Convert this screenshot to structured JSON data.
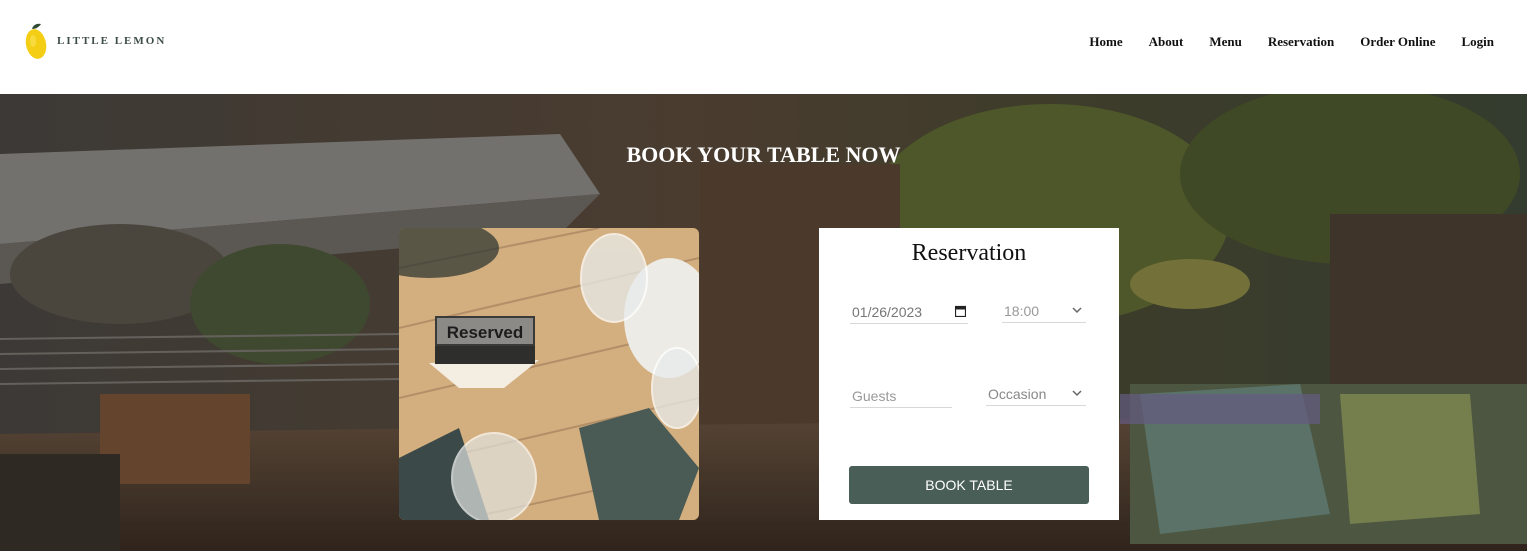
{
  "brand": {
    "name": "LITTLE LEMON"
  },
  "nav": [
    {
      "label": "Home"
    },
    {
      "label": "About"
    },
    {
      "label": "Menu"
    },
    {
      "label": "Reservation"
    },
    {
      "label": "Order Online"
    },
    {
      "label": "Login"
    }
  ],
  "hero": {
    "title": "BOOK YOUR TABLE NOW",
    "photo_sign": "Reserved"
  },
  "form": {
    "title": "Reservation",
    "date_value": "01/26/2023",
    "time_value": "18:00",
    "guests_placeholder": "Guests",
    "occasion_value": "Occasion",
    "submit_label": "BOOK TABLE"
  },
  "icons": {
    "logo": "lemon-icon",
    "date": "calendar-icon",
    "dropdown": "chevron-down-icon"
  },
  "colors": {
    "primary": "#495e57",
    "lemon": "#f4ce14"
  }
}
